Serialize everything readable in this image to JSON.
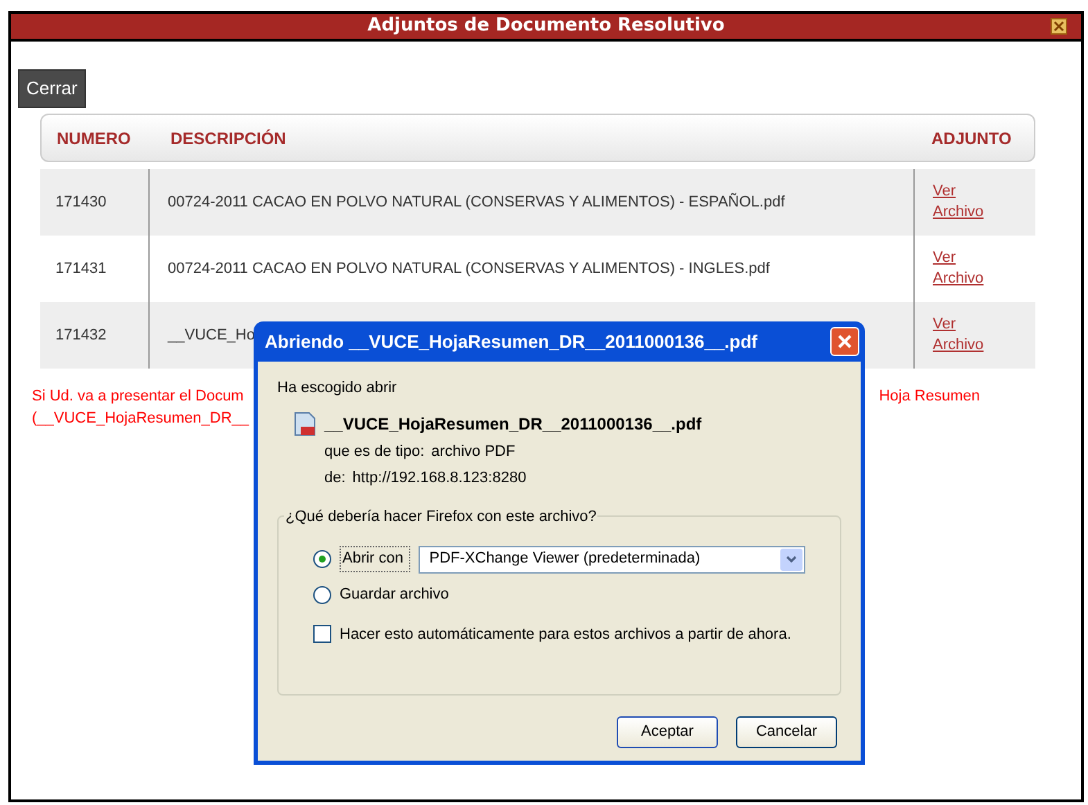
{
  "window": {
    "title": "Adjuntos de Documento Resolutivo"
  },
  "close_button": "Cerrar",
  "table": {
    "columns": [
      "NUMERO",
      "DESCRIPCIÓN",
      "ADJUNTO"
    ],
    "rows": [
      {
        "numero": "171430",
        "descripcion": "00724-2011 CACAO EN POLVO NATURAL (CONSERVAS Y ALIMENTOS) - ESPAÑOL.pdf",
        "adjunto": [
          "Ver",
          "Archivo"
        ]
      },
      {
        "numero": "171431",
        "descripcion": "00724-2011 CACAO EN POLVO NATURAL (CONSERVAS Y ALIMENTOS) - INGLES.pdf",
        "adjunto": [
          "Ver",
          "Archivo"
        ]
      },
      {
        "numero": "171432",
        "descripcion": "__VUCE_Ho",
        "adjunto": [
          "Ver",
          "Archivo"
        ]
      }
    ]
  },
  "note": {
    "line_1_start": "Si Ud. va a presentar el Docum",
    "line_1_end": "Hoja Resumen",
    "line_2": "(__VUCE_HojaResumen_DR__"
  },
  "dialog": {
    "title": "Abriendo __VUCE_HojaResumen_DR__2011000136__.pdf",
    "intro": "Ha escogido abrir",
    "file_name": "__VUCE_HojaResumen_DR__2011000136__.pdf",
    "type_label": "que es de tipo:",
    "type_value": "archivo PDF",
    "from_label": "de:",
    "from_value": "http://192.168.8.123:8280",
    "question": "¿Qué debería hacer Firefox con este archivo?",
    "options": [
      {
        "kind": "open",
        "label": "Abrir con",
        "selected": true,
        "app": "PDF-XChange Viewer (predeterminada)"
      },
      {
        "kind": "save",
        "label": "Guardar archivo",
        "selected": false
      }
    ],
    "auto": {
      "label": "Hacer esto automáticamente para estos archivos a partir de ahora.",
      "checked": false
    },
    "buttons": [
      "Aceptar",
      "Cancelar"
    ]
  }
}
